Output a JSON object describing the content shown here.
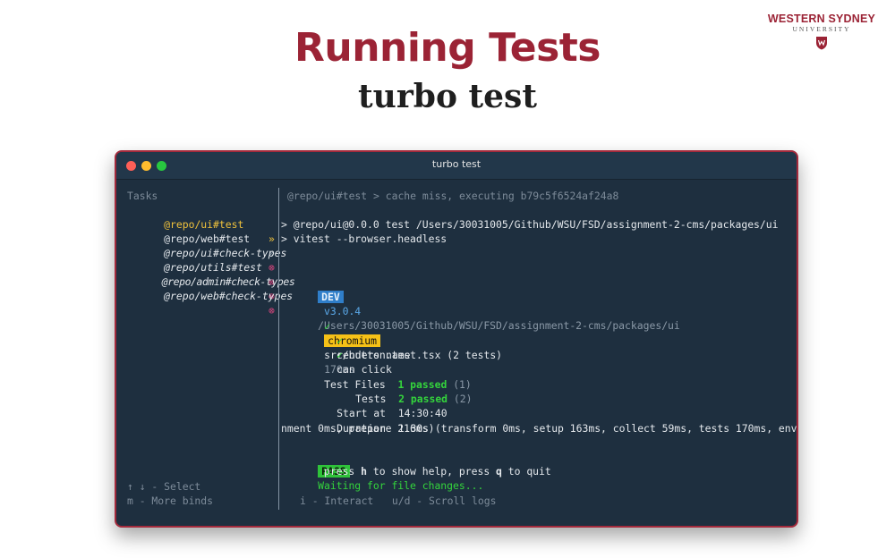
{
  "slide": {
    "title": "Running Tests",
    "subtitle": "turbo test",
    "logo": {
      "line1": "WESTERN SYDNEY",
      "line2": "UNIVERSITY"
    }
  },
  "window": {
    "title": "turbo test",
    "traffic_lights": [
      "close",
      "minimize",
      "maximize"
    ]
  },
  "sidebar": {
    "heading": "Tasks",
    "tasks": [
      {
        "name": "@repo/ui#test",
        "status_icon": "»",
        "state": "selected"
      },
      {
        "name": "@repo/web#test",
        "status_icon": "»",
        "state": "running"
      },
      {
        "name": "@repo/ui#check-types",
        "status_icon": "⊗",
        "state": "pending"
      },
      {
        "name": "@repo/utils#test",
        "status_icon": "⊗",
        "state": "pending"
      },
      {
        "name": "@repo/admin#check-types",
        "status_icon": "⊗",
        "state": "pending"
      },
      {
        "name": "@repo/web#check-types",
        "status_icon": "⊗",
        "state": "pending"
      }
    ],
    "footer": [
      "↑ ↓ - Select",
      "m - More binds"
    ]
  },
  "log": {
    "cache_line": "@repo/ui#test > cache miss, executing b79c5f6524af24a8",
    "cmd1": "> @repo/ui@0.0.0 test /Users/30031005/Github/WSU/FSD/assignment-2-cms/packages/ui",
    "cmd2": "> vitest --browser.headless",
    "dev_badge": "DEV",
    "version": "v3.0.4",
    "dev_path": "/Users/30031005/Github/WSU/FSD/assignment-2-cms/packages/ui",
    "check": "✓",
    "browser_badge": "chromium",
    "test_file": "src/button.test.tsx (2 tests)",
    "test_file_time": "170ms",
    "tests": [
      "renders name",
      "can click"
    ],
    "summary": {
      "files_label": "Test Files",
      "files_value": "1 passed",
      "files_count": "(1)",
      "tests_label": "Tests",
      "tests_value": "2 passed",
      "tests_count": "(2)",
      "start_label": "Start at",
      "start_value": "14:30:40",
      "duration_label": "Duration",
      "duration_value": "1.30s (transform 0ms, setup 163ms, collect 59ms, tests 170ms, enviro",
      "duration_wrap": "nment 0ms, prepare 216ms)"
    },
    "pass_badge": "PASS",
    "waiting": "Waiting for file changes...",
    "help_press1": "press ",
    "help_key1": "h",
    "help_mid": " to show help, press ",
    "help_key2": "q",
    "help_end": " to quit",
    "footer_hints": "i - Interact   u/d - Scroll logs"
  },
  "colors": {
    "accent": "#9b2335",
    "terminal_bg": "#1e2f3f",
    "selected_task": "#f0c23c",
    "pass_green": "#2fc33a",
    "dev_blue": "#2f7ec9"
  }
}
